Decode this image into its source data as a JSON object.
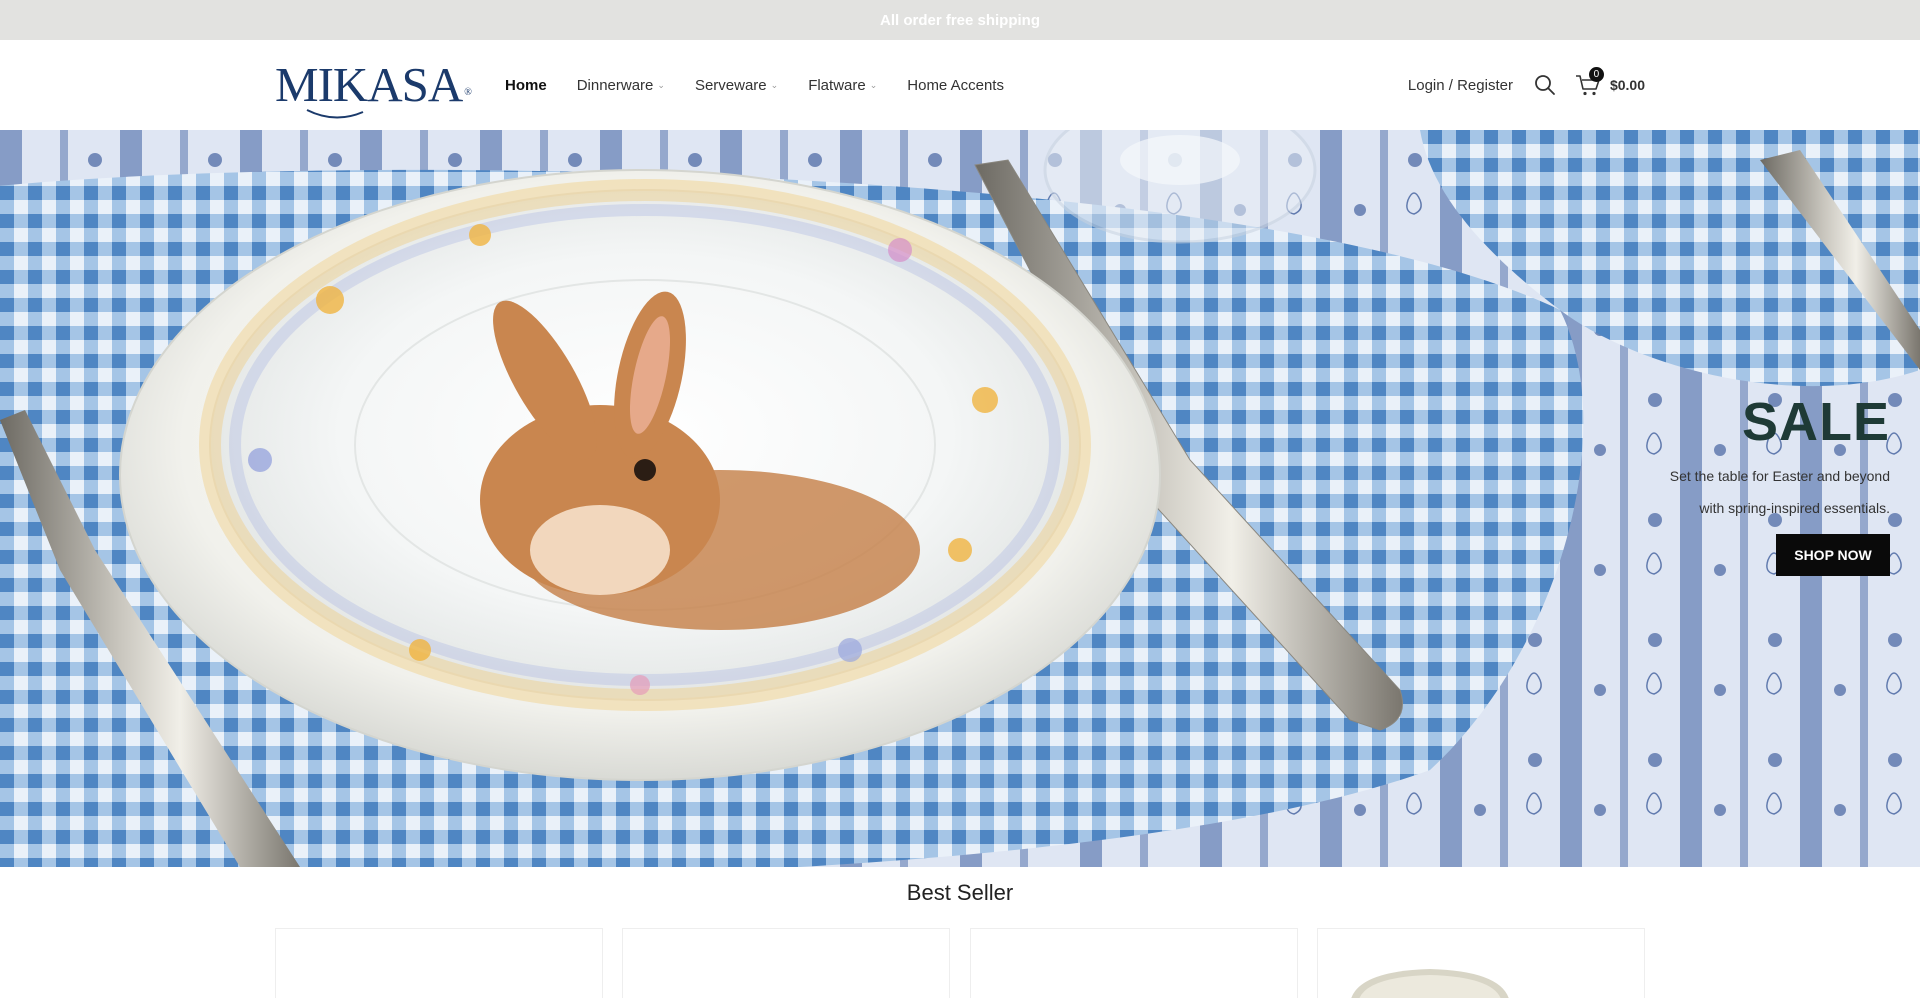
{
  "announcement": "All order free shipping",
  "brand": {
    "logo_text": "MIKASA",
    "logo_mark": "®"
  },
  "nav": {
    "items": [
      {
        "label": "Home",
        "active": true,
        "dropdown": false
      },
      {
        "label": "Dinnerware",
        "active": false,
        "dropdown": true
      },
      {
        "label": "Serveware",
        "active": false,
        "dropdown": true
      },
      {
        "label": "Flatware",
        "active": false,
        "dropdown": true
      },
      {
        "label": "Home Accents",
        "active": false,
        "dropdown": false
      }
    ],
    "dropdown_icon": "chevron-down-icon"
  },
  "header": {
    "login_label": "Login / Register",
    "search_icon": "search-icon",
    "cart_icon": "cart-icon",
    "cart_count": "0",
    "cart_total": "$0.00"
  },
  "hero": {
    "title": "SALE",
    "subtitle_line1": "Set the table for Easter and beyond",
    "subtitle_line2": "with spring-inspired essentials.",
    "cta_label": "SHOP NOW"
  },
  "best_seller": {
    "title": "Best Seller",
    "cards": [
      {},
      {},
      {},
      {}
    ]
  },
  "colors": {
    "announcement_bg": "#e2e2e0",
    "brand_blue": "#1b3a6b",
    "hero_title": "#1e3a36",
    "button_bg": "#0a0a0a",
    "gingham_blue": "#5d95cf"
  }
}
